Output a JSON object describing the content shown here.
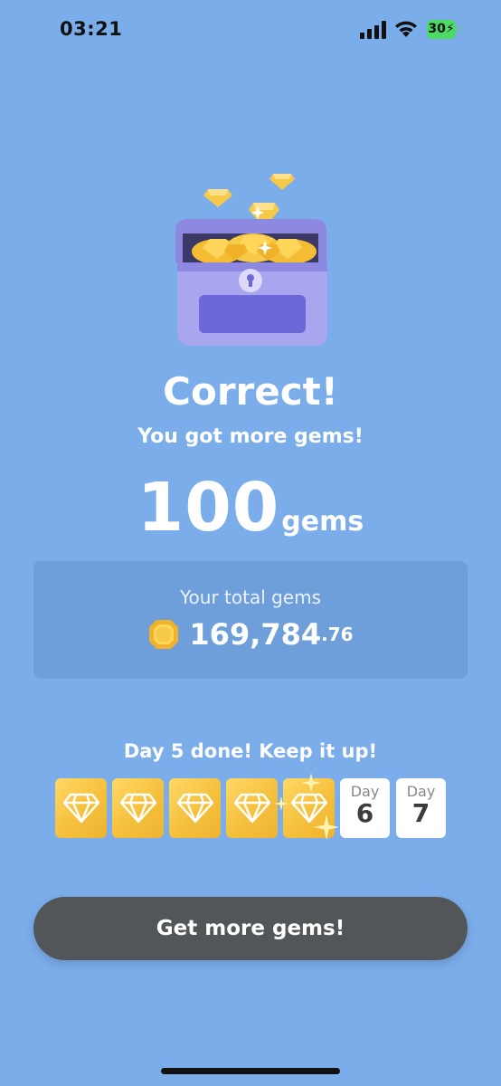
{
  "status_bar": {
    "time": "03:21",
    "battery": "30",
    "icons": [
      "cellular-signal-icon",
      "wifi-icon",
      "battery-charging-icon"
    ]
  },
  "hero": {
    "illustration": "treasure-chest-with-gems",
    "title": "Correct!",
    "subtitle": "You got more gems!"
  },
  "reward": {
    "amount": "100",
    "unit": "gems"
  },
  "total": {
    "label": "Your total gems",
    "icon": "gem-icon",
    "value_main": "169,784",
    "value_decimal": ".76"
  },
  "streak": {
    "label": "Day 5 done! Keep it up!",
    "completed_days": 5,
    "upcoming_days": [
      {
        "label": "Day",
        "number": "6"
      },
      {
        "label": "Day",
        "number": "7"
      }
    ]
  },
  "cta": {
    "label": "Get more gems!"
  },
  "colors": {
    "background": "#7badeb",
    "card": "#6f9fdb",
    "gold": "#f5c03c",
    "button": "#525659",
    "chest_purple": "#9b97e8"
  }
}
